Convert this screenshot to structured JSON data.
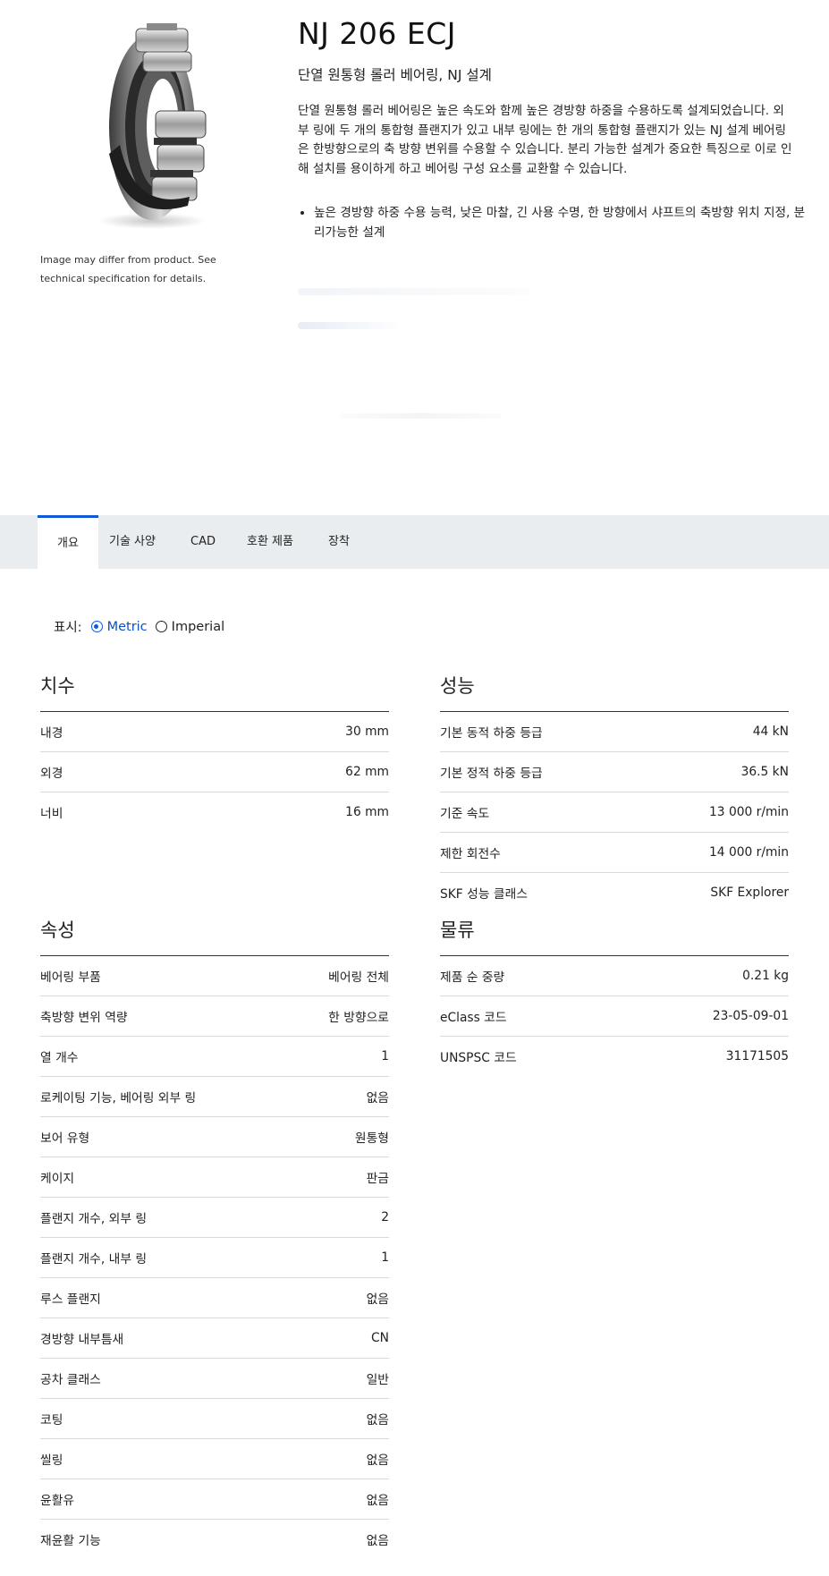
{
  "product": {
    "title": "NJ 206 ECJ",
    "subtitle": "단열 원통형 롤러 베어링, NJ 설계",
    "description": "단열 원통형 롤러 베어링은 높은 속도와 함께 높은 경방향 하중을 수용하도록 설계되었습니다. 외부 링에 두 개의 통합형 플랜지가 있고 내부 링에는 한 개의 통합형 플랜지가 있는 NJ 설계 베어링은 한방향으로의 축 방향 변위를 수용할 수 있습니다. 분리 가능한 설계가 중요한 특징으로 이로 인해 설치를 용이하게 하고 베어링 구성 요소를 교환할 수 있습니다.",
    "bullets": [
      "높은 경방향 하중 수용 능력, 낮은 마찰, 긴 사용 수명, 한 방향에서 샤프트의 축방향 위치 지정, 분리가능한 설계"
    ],
    "image_note": "Image may differ from product. See technical specification for details."
  },
  "tabs": [
    {
      "label": "개요",
      "active": true
    },
    {
      "label": "기술 사양",
      "active": false
    },
    {
      "label": "CAD",
      "active": false
    },
    {
      "label": "호환 제품",
      "active": false
    },
    {
      "label": "장착",
      "active": false
    }
  ],
  "units": {
    "label": "표시:",
    "options": [
      "Metric",
      "Imperial"
    ],
    "selected": "Metric"
  },
  "sections": {
    "dimensions": {
      "title": "치수",
      "rows": [
        {
          "label": "내경",
          "value": "30 mm"
        },
        {
          "label": "외경",
          "value": "62 mm"
        },
        {
          "label": "너비",
          "value": "16 mm"
        }
      ]
    },
    "performance": {
      "title": "성능",
      "rows": [
        {
          "label": "기본 동적 하중 등급",
          "value": "44 kN"
        },
        {
          "label": "기본 정적 하중 등급",
          "value": "36.5 kN"
        },
        {
          "label": "기준 속도",
          "value": "13 000 r/min"
        },
        {
          "label": "제한 회전수",
          "value": "14 000 r/min"
        },
        {
          "label": "SKF 성능 클래스",
          "value": "SKF Explorer"
        }
      ]
    },
    "properties": {
      "title": "속성",
      "rows": [
        {
          "label": "베어링 부품",
          "value": "베어링 전체"
        },
        {
          "label": "축방향 변위 역량",
          "value": "한 방향으로"
        },
        {
          "label": "열 개수",
          "value": "1"
        },
        {
          "label": "로케이팅 기능, 베어링 외부 링",
          "value": "없음"
        },
        {
          "label": "보어 유형",
          "value": "원통형"
        },
        {
          "label": "케이지",
          "value": "판금"
        },
        {
          "label": "플랜지 개수, 외부 링",
          "value": "2"
        },
        {
          "label": "플랜지 개수, 내부 링",
          "value": "1"
        },
        {
          "label": "루스 플랜지",
          "value": "없음"
        },
        {
          "label": "경방향 내부틈새",
          "value": "CN"
        },
        {
          "label": "공차 클래스",
          "value": "일반"
        },
        {
          "label": "코팅",
          "value": "없음"
        },
        {
          "label": "씰링",
          "value": "없음"
        },
        {
          "label": "윤활유",
          "value": "없음"
        },
        {
          "label": "재윤활 기능",
          "value": "없음"
        }
      ]
    },
    "logistics": {
      "title": "물류",
      "rows": [
        {
          "label": "제품 순 중량",
          "value": "0.21 kg"
        },
        {
          "label": "eClass 코드",
          "value": "23-05-09-01"
        },
        {
          "label": "UNSPSC 코드",
          "value": "31171505"
        }
      ]
    }
  },
  "colors": {
    "accent": "#0f58d6",
    "tabbar_bg": "#e9edef",
    "text": "#1a1a1a"
  }
}
